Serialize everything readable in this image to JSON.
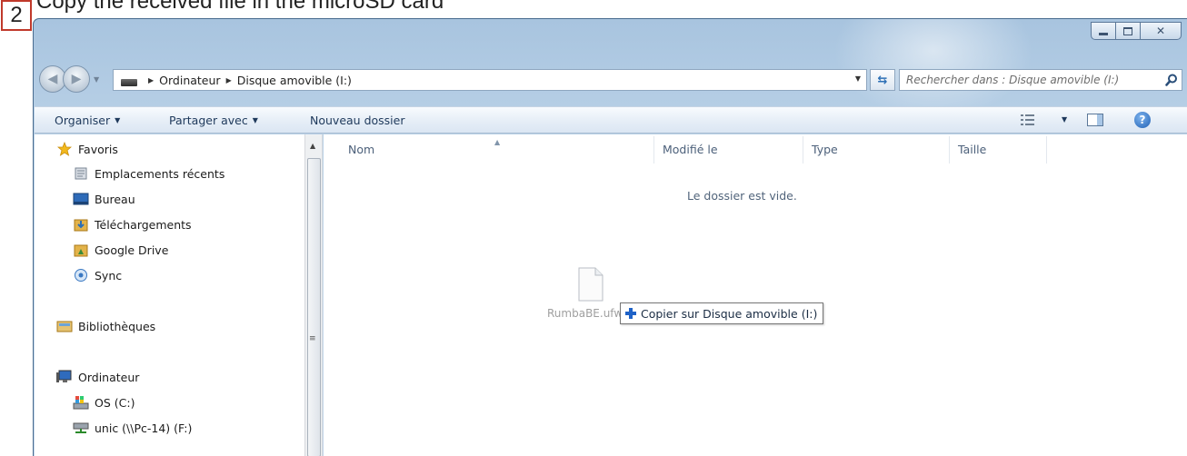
{
  "page": {
    "step_number": "2",
    "heading": "Copy the received file in the microSD card"
  },
  "window": {
    "caption_buttons": [
      "minimize",
      "maximize",
      "close"
    ]
  },
  "address_bar": {
    "crumbs": [
      "Ordinateur",
      "Disque amovible (I:)"
    ],
    "drive_icon": "removable-drive-icon"
  },
  "search": {
    "placeholder": "Rechercher dans : Disque amovible (I:)"
  },
  "toolbar": {
    "organize": "Organiser",
    "share": "Partager avec",
    "new_folder": "Nouveau dossier"
  },
  "nav_pane": {
    "favorites": {
      "label": "Favoris",
      "items": [
        "Emplacements récents",
        "Bureau",
        "Téléchargements",
        "Google Drive",
        "Sync"
      ]
    },
    "libraries": {
      "label": "Bibliothèques"
    },
    "computer": {
      "label": "Ordinateur",
      "items": [
        "OS (C:)",
        "unic (\\\\Pc-14) (F:)"
      ]
    }
  },
  "file_list": {
    "columns": [
      "Nom",
      "Modifié le",
      "Type",
      "Taille"
    ],
    "empty_message": "Le dossier est vide."
  },
  "drag": {
    "file_name": "RumbaBE.ufw",
    "tooltip": "Copier sur Disque amovible (I:)"
  }
}
